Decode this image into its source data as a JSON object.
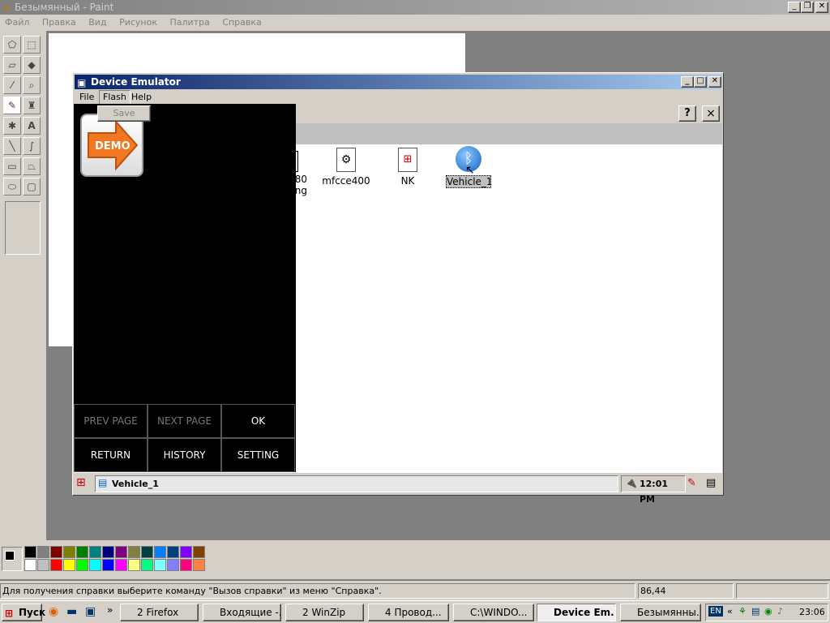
{
  "paint": {
    "title": "Безымянный - Paint",
    "menu": [
      "Файл",
      "Правка",
      "Вид",
      "Рисунок",
      "Палитра",
      "Справка"
    ],
    "status_text": "Для получения справки выберите команду \"Вызов справки\" из меню \"Справка\".",
    "coords": "86,44",
    "palette": [
      "#000000",
      "#808080",
      "#800000",
      "#808000",
      "#008000",
      "#008080",
      "#000080",
      "#800080",
      "#808040",
      "#004040",
      "#0080ff",
      "#004080",
      "#8000ff",
      "#804000",
      "#ffffff",
      "#c0c0c0",
      "#ff0000",
      "#ffff00",
      "#00ff00",
      "#00ffff",
      "#0000ff",
      "#ff00ff",
      "#ffff80",
      "#00ff80",
      "#80ffff",
      "#8080ff",
      "#ff0080",
      "#ff8040"
    ]
  },
  "emulator": {
    "title": "Device Emulator",
    "menu": [
      "File",
      "Flash",
      "Help"
    ],
    "flash_submenu": "Save",
    "demo_label": "DEMO",
    "partial_icon_line1": "80",
    "partial_icon_line2": "ng",
    "icons": [
      "mfcce400",
      "NK",
      "Vehicle_1"
    ],
    "buttons": {
      "prev": "PREV PAGE",
      "next": "NEXT PAGE",
      "ok": "OK",
      "return": "RETURN",
      "history": "HISTORY",
      "setting": "SETTING"
    },
    "taskbar_item": "Vehicle_1",
    "clock": "12:01 PM",
    "help_btn": "?",
    "close_btn": "×"
  },
  "taskbar": {
    "start": "Пуск",
    "items": [
      "2 Firefox",
      "Входящие -...",
      "2 WinZip",
      "4 Провод...",
      "C:\\WINDO...",
      "Device Em...",
      "Безымянны..."
    ],
    "lang": "EN",
    "time": "23:06"
  }
}
